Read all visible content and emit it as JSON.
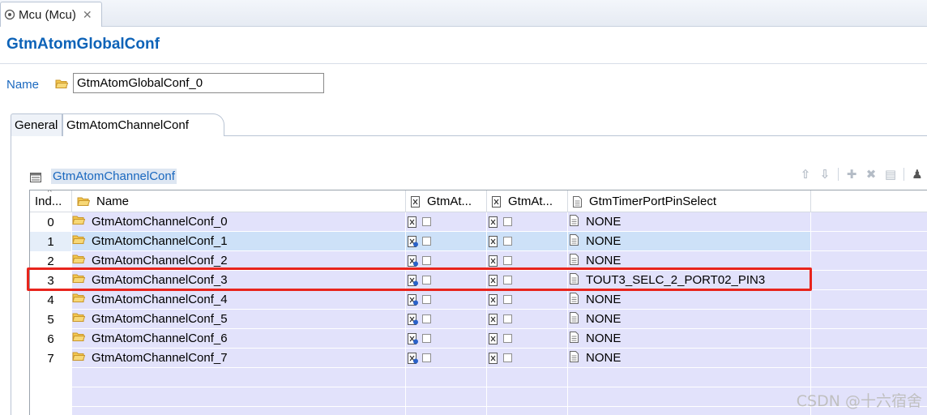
{
  "editor_tab": {
    "label": "Mcu (Mcu)",
    "close_glyph": "✕",
    "icon": "mcu-module-icon"
  },
  "header": {
    "title": "GtmAtomGlobalConf"
  },
  "name_field": {
    "label": "Name",
    "value": "GtmAtomGlobalConf_0"
  },
  "inner_tabs": [
    {
      "label": "General"
    },
    {
      "label": "GtmAtomChannelConf"
    }
  ],
  "section": {
    "title": "GtmAtomChannelConf"
  },
  "toolbar": {
    "items": [
      "move-up-icon",
      "move-down-icon",
      "add-icon",
      "delete-icon",
      "copy-icon",
      "more-icon"
    ],
    "glyphs": {
      "up": "⇧",
      "down": "⇩",
      "add": "✚",
      "delete": "✖",
      "copy": "▤",
      "more": "♟"
    }
  },
  "table": {
    "columns": [
      "Ind...",
      "Name",
      "GtmAt...",
      "GtmAt...",
      "GtmTimerPortPinSelect"
    ],
    "rows": [
      {
        "index": "0",
        "name": "GtmAtomChannelConf_0",
        "pin": "NONE"
      },
      {
        "index": "1",
        "name": "GtmAtomChannelConf_1",
        "pin": "NONE"
      },
      {
        "index": "2",
        "name": "GtmAtomChannelConf_2",
        "pin": "NONE"
      },
      {
        "index": "3",
        "name": "GtmAtomChannelConf_3",
        "pin": "TOUT3_SELC_2_PORT02_PIN3"
      },
      {
        "index": "4",
        "name": "GtmAtomChannelConf_4",
        "pin": "NONE"
      },
      {
        "index": "5",
        "name": "GtmAtomChannelConf_5",
        "pin": "NONE"
      },
      {
        "index": "6",
        "name": "GtmAtomChannelConf_6",
        "pin": "NONE"
      },
      {
        "index": "7",
        "name": "GtmAtomChannelConf_7",
        "pin": "NONE"
      }
    ],
    "selected_row": 1,
    "highlighted_row": 3
  },
  "colors": {
    "accent": "#0e63b8",
    "row_bg": "#e2e2fb",
    "selected_bg": "#cde1f8",
    "highlight": "#e8241c"
  },
  "watermark": "CSDN @十六宿舍"
}
